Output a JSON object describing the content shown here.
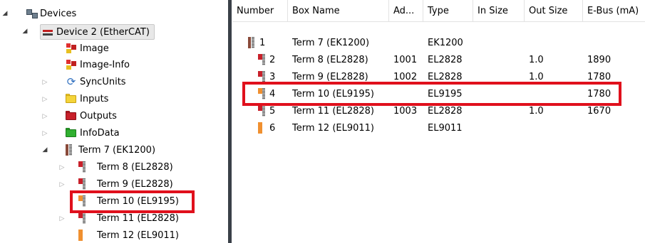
{
  "tree": {
    "root_label": "Devices",
    "device_label": "Device 2 (EtherCAT)",
    "children": [
      {
        "label": "Image",
        "icon": "image-icon"
      },
      {
        "label": "Image-Info",
        "icon": "image-info-icon"
      },
      {
        "label": "SyncUnits",
        "icon": "sync-icon"
      },
      {
        "label": "Inputs",
        "icon": "inputs-folder-icon"
      },
      {
        "label": "Outputs",
        "icon": "outputs-folder-icon"
      },
      {
        "label": "InfoData",
        "icon": "infodata-folder-icon"
      }
    ],
    "coupler_label": "Term 7 (EK1200)",
    "terminals": [
      {
        "label": "Term 8 (EL2828)"
      },
      {
        "label": "Term 9 (EL2828)"
      },
      {
        "label": "Term 10 (EL9195)"
      },
      {
        "label": "Term 11 (EL2828)"
      },
      {
        "label": "Term 12 (EL9011)"
      }
    ]
  },
  "grid": {
    "columns": [
      "Number",
      "Box Name",
      "Ad...",
      "Type",
      "In Size",
      "Out Size",
      "E-Bus (mA)"
    ],
    "rows": [
      {
        "number": "1",
        "box": "Term 7 (EK1200)",
        "addr": "",
        "type": "EK1200",
        "in": "",
        "out": "",
        "ebus": ""
      },
      {
        "number": "2",
        "box": "Term 8 (EL2828)",
        "addr": "1001",
        "type": "EL2828",
        "in": "",
        "out": "1.0",
        "ebus": "1890"
      },
      {
        "number": "3",
        "box": "Term 9 (EL2828)",
        "addr": "1002",
        "type": "EL2828",
        "in": "",
        "out": "1.0",
        "ebus": "1780"
      },
      {
        "number": "4",
        "box": "Term 10 (EL9195)",
        "addr": "",
        "type": "EL9195",
        "in": "",
        "out": "",
        "ebus": "1780"
      },
      {
        "number": "5",
        "box": "Term 11 (EL2828)",
        "addr": "1003",
        "type": "EL2828",
        "in": "",
        "out": "1.0",
        "ebus": "1670"
      },
      {
        "number": "6",
        "box": "Term 12 (EL9011)",
        "addr": "",
        "type": "EL9011",
        "in": "",
        "out": "",
        "ebus": ""
      }
    ]
  },
  "colors": {
    "highlight": "#e0101c",
    "splitter": "#3a4048"
  }
}
